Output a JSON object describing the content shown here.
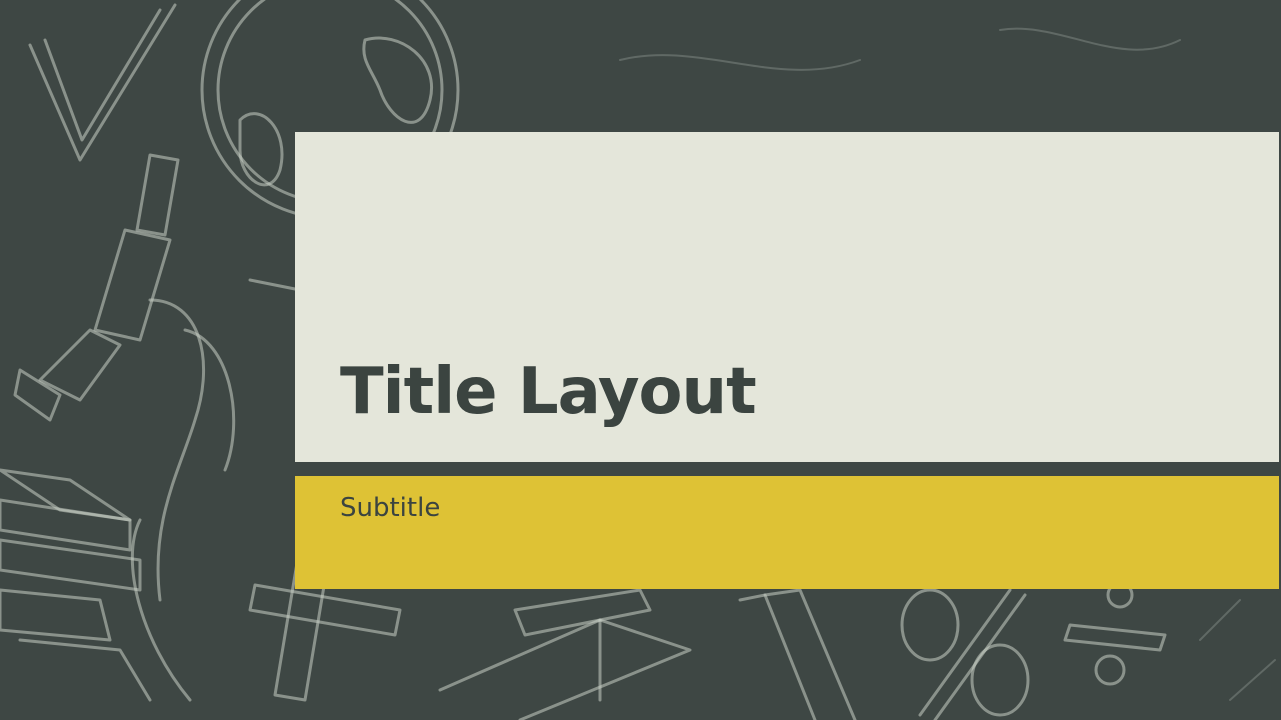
{
  "slide": {
    "title": "Title Layout",
    "subtitle": "Subtitle"
  },
  "colors": {
    "background": "#3e4744",
    "chalk": "#c9cfc6",
    "title_panel": "#e4e6da",
    "subtitle_band": "#dec235",
    "title_text": "#3b4440",
    "subtitle_text": "#3b4440"
  },
  "decorations": [
    "chalk-checkmark-icon",
    "chalk-globe-icon",
    "chalk-microscope-icon",
    "chalk-books-icon",
    "chalk-plus-icon",
    "chalk-open-book-icon",
    "chalk-ruler-icon",
    "chalk-percent-icon",
    "chalk-divide-icon"
  ]
}
